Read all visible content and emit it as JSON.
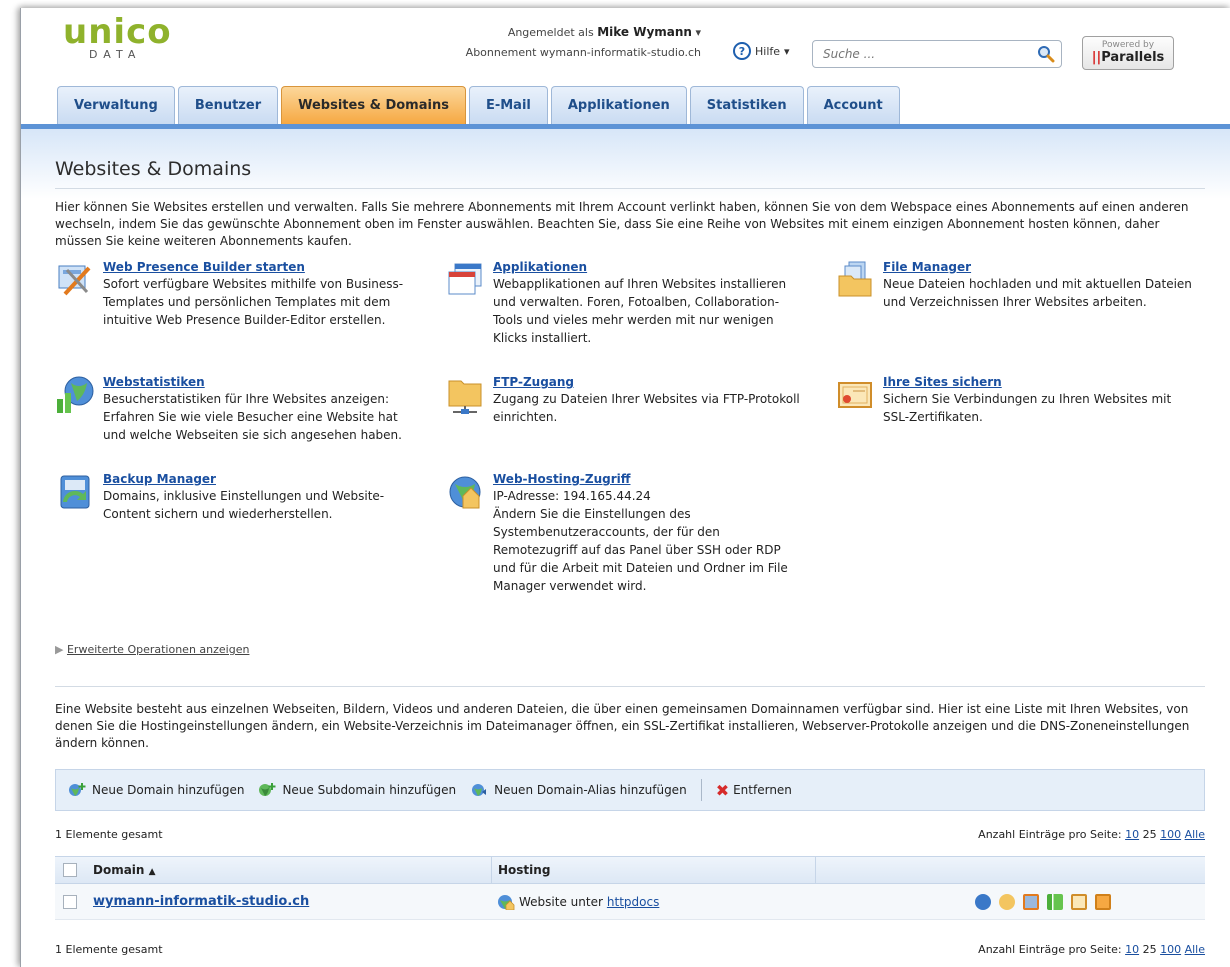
{
  "brand": {
    "logo_word": "unico",
    "logo_sub": "DATA",
    "logo_color": "#8fb22c"
  },
  "header": {
    "logged_in_prefix": "Angemeldet als",
    "user_name": "Mike Wymann",
    "subscription": "Abonnement wymann-informatik-studio.ch",
    "help_label": "Hilfe",
    "search_placeholder": "Suche ...",
    "powered_by": "Powered by",
    "powered_brand": "Parallels"
  },
  "tabs": [
    "Verwaltung",
    "Benutzer",
    "Websites & Domains",
    "E-Mail",
    "Applikationen",
    "Statistiken",
    "Account"
  ],
  "active_tab": "Websites & Domains",
  "page": {
    "title": "Websites & Domains",
    "intro": "Hier können Sie Websites erstellen und verwalten. Falls Sie mehrere Abonnements mit Ihrem Account verlinkt haben, können Sie von dem Webspace eines Abonnements auf einen anderen wechseln, indem Sie das gewünschte Abonnement oben im Fenster auswählen. Beachten Sie, dass Sie eine Reihe von Websites mit einem einzigen Abonnement hosten können, daher müssen Sie keine weiteren Abonnements kaufen."
  },
  "tools": [
    {
      "title": "Web Presence Builder starten",
      "desc": "Sofort verfügbare Websites mithilfe von Business-Templates und persönlichen Templates mit dem intuitive Web Presence Builder-Editor erstellen.",
      "icon": "builder-icon"
    },
    {
      "title": "Applikationen",
      "desc": "Webapplikationen auf Ihren Websites installieren und verwalten. Foren, Fotoalben, Collaboration-Tools und vieles mehr werden mit nur wenigen Klicks installiert.",
      "icon": "applications-icon"
    },
    {
      "title": "File Manager",
      "desc": "Neue Dateien hochladen und mit aktuellen Dateien und Verzeichnissen Ihrer Websites arbeiten.",
      "icon": "file-manager-icon"
    },
    {
      "title": "Webstatistiken",
      "desc": "Besucherstatistiken für Ihre Websites anzeigen: Erfahren Sie wie viele Besucher eine Website hat und welche Webseiten sie sich angesehen haben.",
      "icon": "web-stats-icon"
    },
    {
      "title": "FTP-Zugang",
      "desc": "Zugang zu Dateien Ihrer Websites via FTP-Protokoll einrichten.",
      "icon": "ftp-icon"
    },
    {
      "title": "Ihre Sites sichern",
      "desc": "Sichern Sie Verbindungen zu Ihren Websites mit SSL-Zertifikaten.",
      "icon": "certificate-icon"
    },
    {
      "title": "Backup Manager",
      "desc": "Domains, inklusive Einstellungen und Website-Content sichern und wiederherstellen.",
      "icon": "backup-icon"
    },
    {
      "title": "Web-Hosting-Zugriff",
      "desc": "IP-Adresse: 194.165.44.24\nÄndern Sie die Einstellungen des Systembenutzeraccounts, der für den Remotezugriff auf das Panel über SSH oder RDP und für die Arbeit mit Dateien und Ordner im File Manager verwendet wird.",
      "icon": "hosting-icon"
    }
  ],
  "advanced_link": "Erweiterte Operationen anzeigen",
  "sites_desc": "Eine Website besteht aus einzelnen Webseiten, Bildern, Videos und anderen Dateien, die über einen gemeinsamen Domainnamen verfügbar sind. Hier ist eine Liste mit Ihren Websites, von denen Sie die Hostingeinstellungen ändern, ein Website-Verzeichnis im Dateimanager öffnen, ein SSL-Zertifikat installieren, Webserver-Protokolle anzeigen und die DNS-Zoneneinstellungen ändern können.",
  "toolbar": {
    "add_domain": "Neue Domain hinzufügen",
    "add_subdomain": "Neue Subdomain hinzufügen",
    "add_alias": "Neuen Domain-Alias hinzufügen",
    "remove": "Entfernen"
  },
  "pagination": {
    "total": "1 Elemente gesamt",
    "per_page_label": "Anzahl Einträge pro Seite:",
    "opt_10": "10",
    "opt_25": "25",
    "opt_100": "100",
    "opt_all": "Alle"
  },
  "table": {
    "col_domain": "Domain",
    "sort_arrow": "▲",
    "col_hosting": "Hosting",
    "rows": [
      {
        "domain": "wymann-informatik-studio.ch",
        "hosting_prefix": "Website unter",
        "hosting_link": "httpdocs"
      }
    ]
  }
}
